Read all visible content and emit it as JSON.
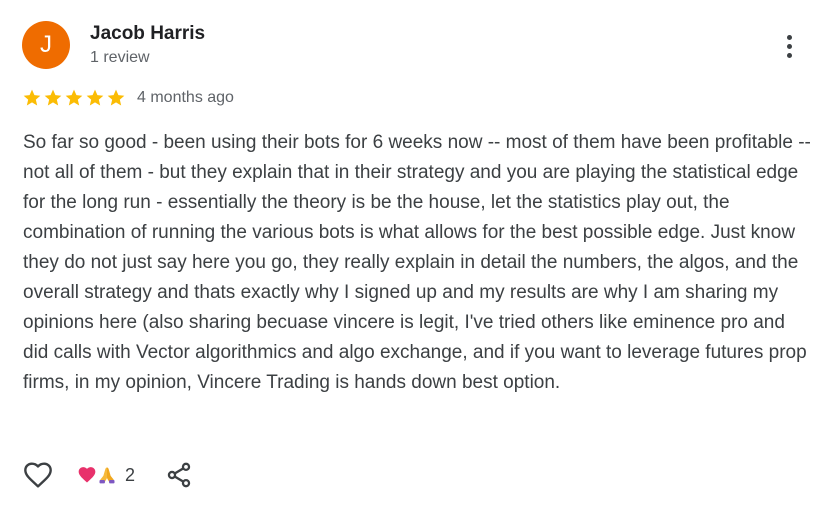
{
  "review": {
    "author": {
      "initial": "J",
      "name": "Jacob Harris",
      "review_count_label": "1 review",
      "avatar_color": "#ef6c00"
    },
    "rating": 5,
    "rating_max": 5,
    "star_color": "#fbbc04",
    "date": "4 months ago",
    "text": "So far so good - been using their bots for 6 weeks now -- most of them have been profitable -- not all of them - but they explain that in their strategy and you are playing the statistical edge for the long run - essentially the theory is be the house, let the statistics play out, the combination of running the various bots is what allows for the best possible edge. Just know they do not just say here you go, they really explain in detail the numbers, the algos, and the overall strategy and thats exactly why I signed up and my results are why I am sharing my opinions here (also sharing becuase vincere is legit, I've tried others like eminence pro and did calls with Vector algorithmics and algo exchange, and if you want to leverage futures prop firms, in my opinion, Vincere Trading is hands down best option.",
    "reactions": {
      "icons": [
        "heart-icon",
        "praying-hands-icon"
      ],
      "count": "2"
    },
    "actions": {
      "like_icon": "heart-outline-icon",
      "share_icon": "share-icon",
      "more_icon": "more-vert-icon"
    }
  }
}
